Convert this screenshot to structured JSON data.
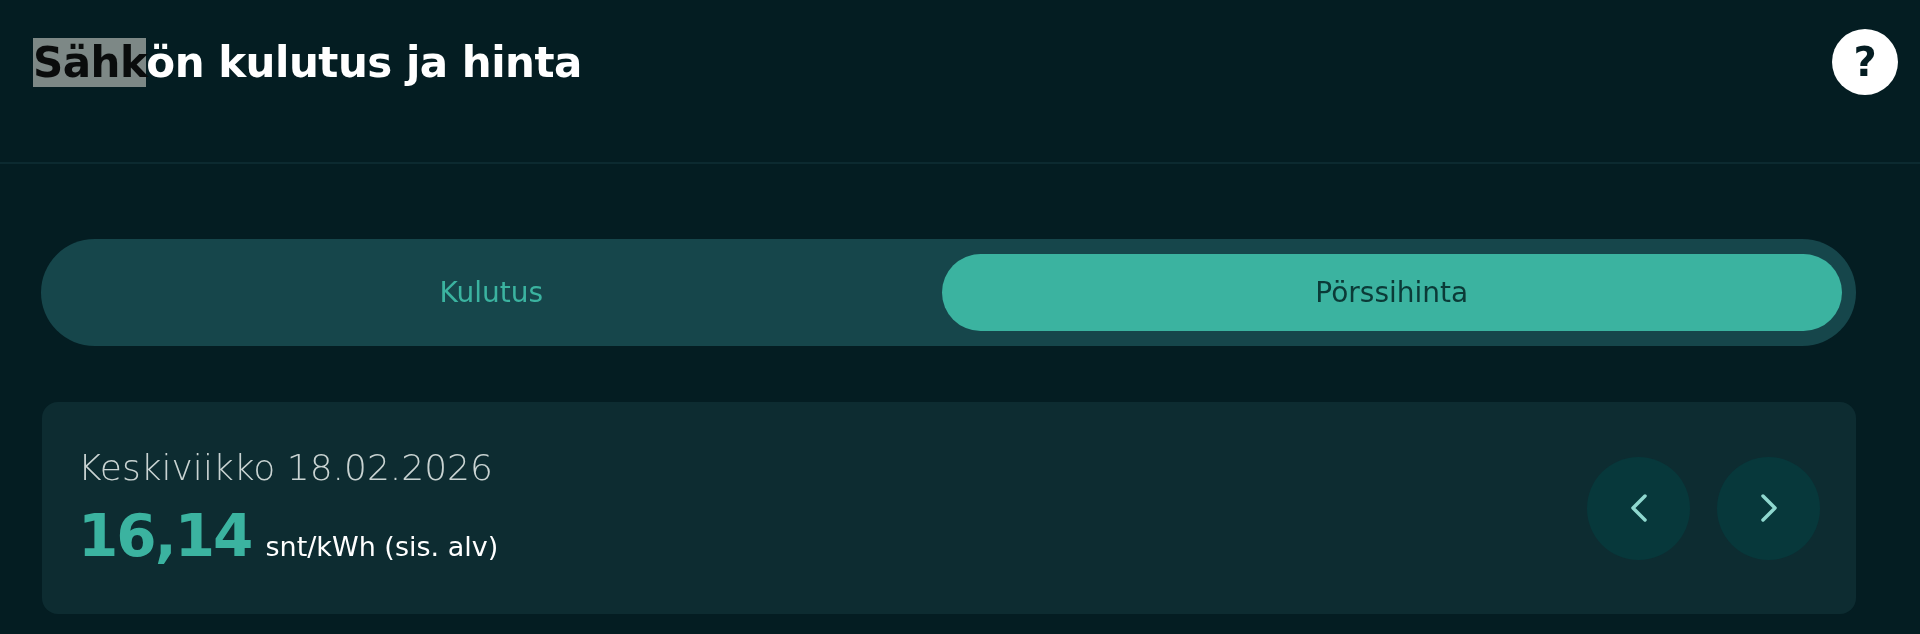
{
  "header": {
    "title": [
      {
        "text": "Sähk",
        "highlighted": true
      },
      {
        "text": "ön kulutus ja hinta",
        "highlighted": false
      }
    ],
    "help_button": "?"
  },
  "tabs": [
    {
      "label": "Kulutus",
      "selected": false
    },
    {
      "label": "Pörssihinta",
      "selected": true
    }
  ],
  "price_card": {
    "date": "Keskiviikko 18.02.2026",
    "price": "16,14",
    "unit": "snt/kWh (sis. alv)"
  }
}
